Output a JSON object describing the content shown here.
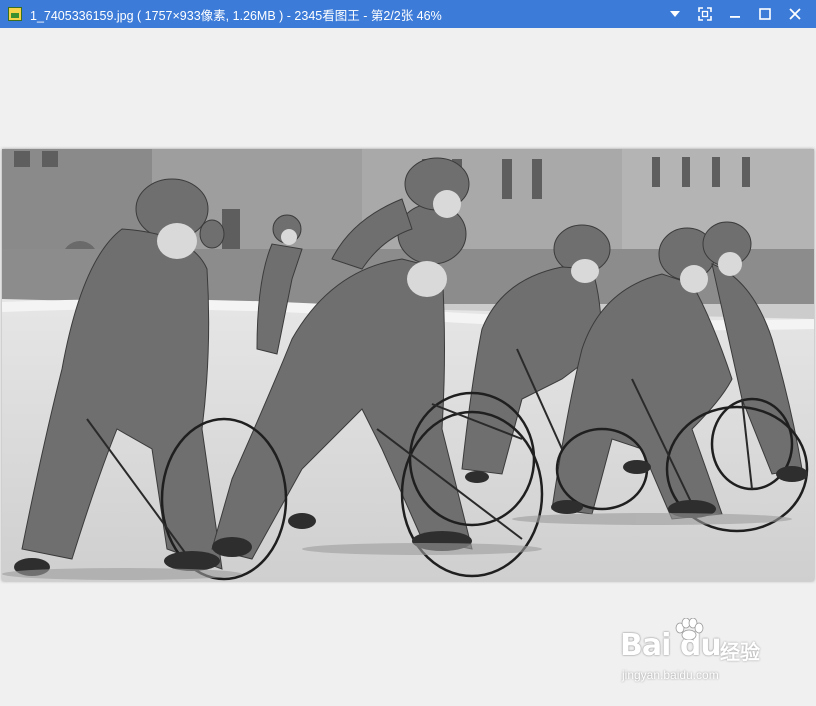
{
  "window": {
    "title": "1_7405336159.jpg ( 1757×933像素, 1.26MB ) - 2345看图王 - 第2/2张 46%",
    "icon": "app-image-icon",
    "controls": [
      "dropdown-icon",
      "fullscreen-icon",
      "minimize-icon",
      "maximize-icon",
      "close-icon"
    ]
  },
  "colors": {
    "titlebar": "#3c7bd8",
    "viewer_background": "#f0f0f0"
  },
  "image": {
    "description_icon": "photo-children-rolling-hoops"
  },
  "watermark": {
    "logo_text": "Bai du",
    "sub_text": "经验",
    "url": "jingyan.baidu.com"
  }
}
